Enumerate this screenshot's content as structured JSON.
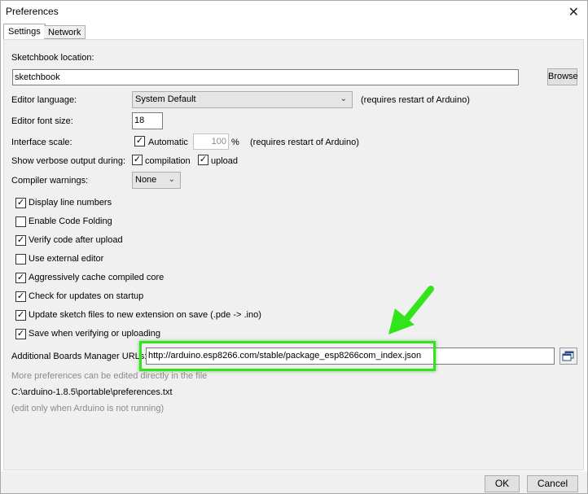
{
  "window": {
    "title": "Preferences"
  },
  "tabs": [
    {
      "label": "Settings"
    },
    {
      "label": "Network"
    }
  ],
  "settings": {
    "sketchbook_label": "Sketchbook location:",
    "sketchbook_value": "sketchbook",
    "browse_label": "Browse",
    "editor_language_label": "Editor language:",
    "editor_language_value": "System Default",
    "requires_restart_1": "(requires restart of Arduino)",
    "font_size_label": "Editor font size:",
    "font_size_value": "18",
    "interface_scale_label": "Interface scale:",
    "automatic_label": "Automatic",
    "scale_value": "100",
    "percent": "%",
    "requires_restart_2": "(requires restart of Arduino)",
    "verbose_label": "Show verbose output during:",
    "compilation_label": "compilation",
    "upload_label": "upload",
    "compiler_warnings_label": "Compiler warnings:",
    "compiler_warnings_value": "None",
    "checkboxes": [
      {
        "label": "Display line numbers",
        "checked": true
      },
      {
        "label": "Enable Code Folding",
        "checked": false
      },
      {
        "label": "Verify code after upload",
        "checked": true
      },
      {
        "label": "Use external editor",
        "checked": false
      },
      {
        "label": "Aggressively cache compiled core",
        "checked": true
      },
      {
        "label": "Check for updates on startup",
        "checked": true
      },
      {
        "label": "Update sketch files to new extension on save (.pde -> .ino)",
        "checked": true
      },
      {
        "label": "Save when verifying or uploading",
        "checked": true
      }
    ],
    "boards_urls_label": "Additional Boards Manager URLs:",
    "boards_urls_value": "http://arduino.esp8266.com/stable/package_esp8266com_index.json",
    "more_prefs_text": "More preferences can be edited directly in the file",
    "prefs_path": "C:\\arduino-1.8.5\\portable\\preferences.txt",
    "edit_note": "(edit only when Arduino is not running)"
  },
  "footer": {
    "ok_label": "OK",
    "cancel_label": "Cancel"
  },
  "colors": {
    "highlight": "#32e51a",
    "arrow": "#32e51a"
  },
  "icons": {
    "close": "close-icon",
    "window_list": "window-list-icon",
    "chevron": "chevron-down-icon",
    "check": "check-icon",
    "annotation_arrow": "arrow-icon"
  }
}
